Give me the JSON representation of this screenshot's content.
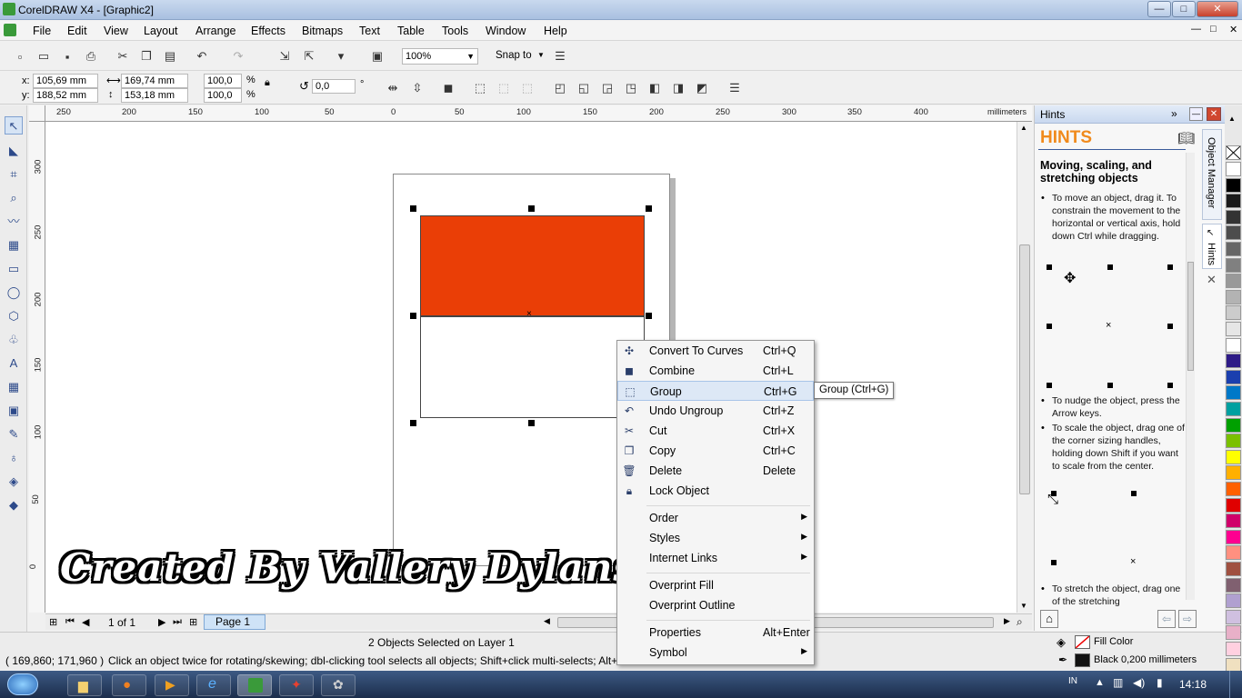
{
  "window": {
    "title": "CorelDRAW X4 - [Graphic2]"
  },
  "menus": [
    "File",
    "Edit",
    "View",
    "Layout",
    "Arrange",
    "Effects",
    "Bitmaps",
    "Text",
    "Table",
    "Tools",
    "Window",
    "Help"
  ],
  "standard_toolbar": {
    "zoom": "100%",
    "snap": "Snap to"
  },
  "property_bar": {
    "x_label": "x:",
    "x_value": "105,69 mm",
    "y_label": "y:",
    "y_value": "188,52 mm",
    "width_value": "169,74 mm",
    "height_value": "153,18 mm",
    "scale_x": "100,0",
    "scale_y": "100,0",
    "percent": "%",
    "rotation": "0,0",
    "degree": "°"
  },
  "ruler": {
    "unit": "millimeters",
    "h_ticks": [
      "250",
      "200",
      "150",
      "100",
      "50",
      "0",
      "50",
      "100",
      "150",
      "200",
      "250",
      "300",
      "350",
      "400"
    ],
    "v_ticks": [
      "300",
      "250",
      "200",
      "150",
      "100",
      "50",
      "0"
    ]
  },
  "context_menu": {
    "items": [
      {
        "label": "Convert To Curves",
        "shortcut": "Ctrl+Q",
        "icon": "convert-curves-icon"
      },
      {
        "label": "Combine",
        "shortcut": "Ctrl+L",
        "icon": "combine-icon"
      },
      {
        "label": "Group",
        "shortcut": "Ctrl+G",
        "icon": "group-icon"
      },
      {
        "label": "Undo Ungroup",
        "shortcut": "Ctrl+Z",
        "icon": "undo-icon"
      },
      {
        "label": "Cut",
        "shortcut": "Ctrl+X",
        "icon": "scissors-icon"
      },
      {
        "label": "Copy",
        "shortcut": "Ctrl+C",
        "icon": "copy-icon"
      },
      {
        "label": "Delete",
        "shortcut": "Delete",
        "icon": "trash-icon"
      },
      {
        "label": "Lock Object",
        "shortcut": "",
        "icon": "lock-icon"
      },
      {
        "label": "Order",
        "shortcut": "",
        "icon": ""
      },
      {
        "label": "Styles",
        "shortcut": "",
        "icon": ""
      },
      {
        "label": "Internet Links",
        "shortcut": "",
        "icon": ""
      },
      {
        "label": "Overprint Fill",
        "shortcut": "",
        "icon": ""
      },
      {
        "label": "Overprint Outline",
        "shortcut": "",
        "icon": ""
      },
      {
        "label": "Properties",
        "shortcut": "Alt+Enter",
        "icon": ""
      },
      {
        "label": "Symbol",
        "shortcut": "",
        "icon": ""
      }
    ],
    "tooltip": "Group (Ctrl+G)"
  },
  "page_nav": {
    "counter": "1 of 1",
    "page_tab": "Page 1"
  },
  "status": {
    "selection": "2 Objects Selected on Layer 1",
    "coords": "( 169,860; 171,960 )",
    "hint": "Click an object twice for rotating/skewing; dbl-clicking tool selects all objects; Shift+click multi-selects; Alt+click digs; C",
    "fill_label": "Fill Color",
    "outline_label": "Black  0,200 millimeters"
  },
  "docker": {
    "tab_title": "Hints",
    "heading": "HINTS",
    "subheading": "Moving, scaling, and stretching objects",
    "p1": "To move an object, drag it. To constrain the movement to the horizontal or vertical axis, hold down Ctrl while dragging.",
    "p2": "To nudge the object, press the Arrow keys.",
    "p3": "To scale the object, drag one of the corner sizing handles, holding down Shift if you want to scale from the center.",
    "p4": "To stretch the object, drag one of the stretching",
    "side_tab_1": "Object Manager",
    "side_tab_2": "Hints"
  },
  "watermark": "Created By Vallery Dylansha",
  "taskbar": {
    "lang": "IN",
    "time": "14:18"
  },
  "colors": {
    "flag_red": "#ea3e06",
    "menu_highlight": "#dde8f6"
  },
  "palette": [
    "#ffffff",
    "#000000",
    "#1a1a1a",
    "#333333",
    "#4d4d4d",
    "#666666",
    "#808080",
    "#999999",
    "#b3b3b3",
    "#cccccc",
    "#e6e6e6",
    "#ffffff",
    "#2e1b87",
    "#1b3fae",
    "#0078c8",
    "#00a0a0",
    "#00a000",
    "#7ac000",
    "#ffff00",
    "#ffb000",
    "#ff6000",
    "#e00000",
    "#d0006a",
    "#ff0090",
    "#ff9080",
    "#a05040",
    "#806070",
    "#b0a0d0",
    "#d0c0e0",
    "#e8b0c8",
    "#ffd0e0",
    "#f0e0c0",
    "#ffe0a0",
    "#fff0c0",
    "#d0f0e0"
  ]
}
